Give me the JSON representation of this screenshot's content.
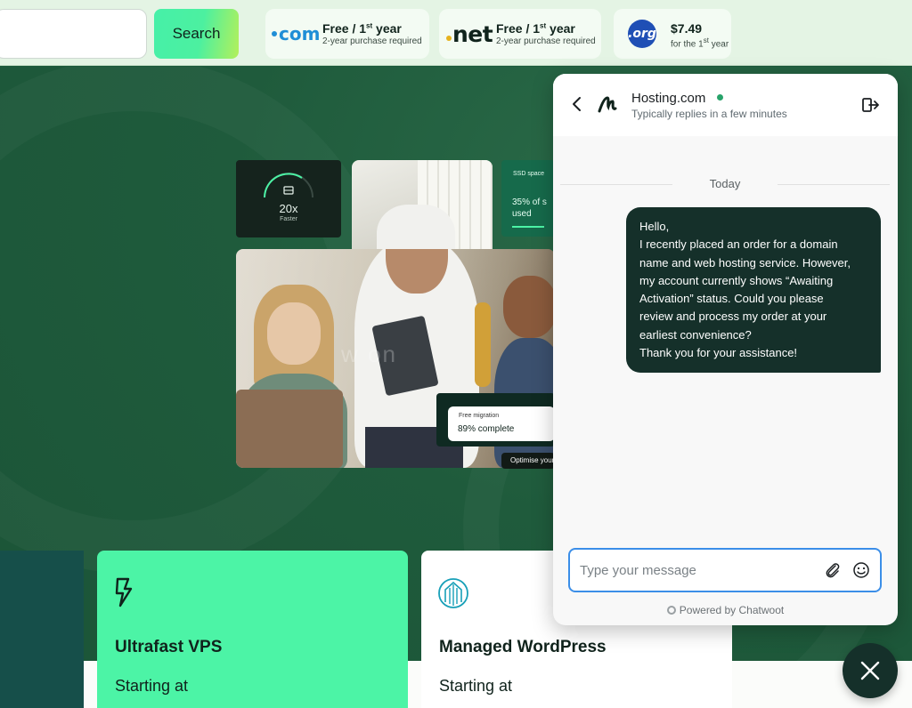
{
  "search": {
    "placeholder": "",
    "button_label": "Search"
  },
  "domains": [
    {
      "tld": ".com",
      "price": "Free / 1",
      "price_sup": "st",
      "price_suffix": " year",
      "note": "2-year purchase required",
      "accent": "#1f8ed6"
    },
    {
      "tld": ".net",
      "price": "Free / 1",
      "price_sup": "st",
      "price_suffix": " year",
      "note": "2-year purchase required",
      "accent": "#e6b21e"
    },
    {
      "tld": ".org",
      "price": "$7.49",
      "note_prefix": "for the 1",
      "note_sup": "st",
      "note_suffix": " year",
      "accent": "#1f4fb5"
    }
  ],
  "hero": {
    "speed_tile": {
      "value": "20x",
      "label": "Faster"
    },
    "ssd_tile": {
      "title": "SSD space",
      "value": "35% of s",
      "value2": "used"
    },
    "migration_tile": {
      "title": "Free migration",
      "value": "89% complete"
    },
    "optimise_label": "Optimise your",
    "watermark": "w  on"
  },
  "products": [
    {
      "title": "Ultrafast VPS",
      "starting": "Starting at",
      "icon": "lightning-icon"
    },
    {
      "title": "Managed WordPress",
      "starting": "Starting at",
      "icon": "wordpress-building-icon"
    }
  ],
  "chat": {
    "name": "Hosting.com",
    "reply_time": "Typically replies in a few minutes",
    "status_color": "#28a36a",
    "date_label": "Today",
    "message_lines": [
      "Hello,",
      "I recently placed an order for a domain",
      "name and web hosting service. However,",
      "my account currently shows “Awaiting",
      "Activation” status. Could you please",
      "review and process my order at your",
      "earliest convenience?",
      "Thank you for your assistance!"
    ],
    "input_placeholder": "Type your message",
    "powered_by": "Powered by Chatwoot"
  },
  "colors": {
    "bubble": "#15302a",
    "focus_border": "#3b8ee8",
    "search_gradient_start": "#46f0a8"
  }
}
